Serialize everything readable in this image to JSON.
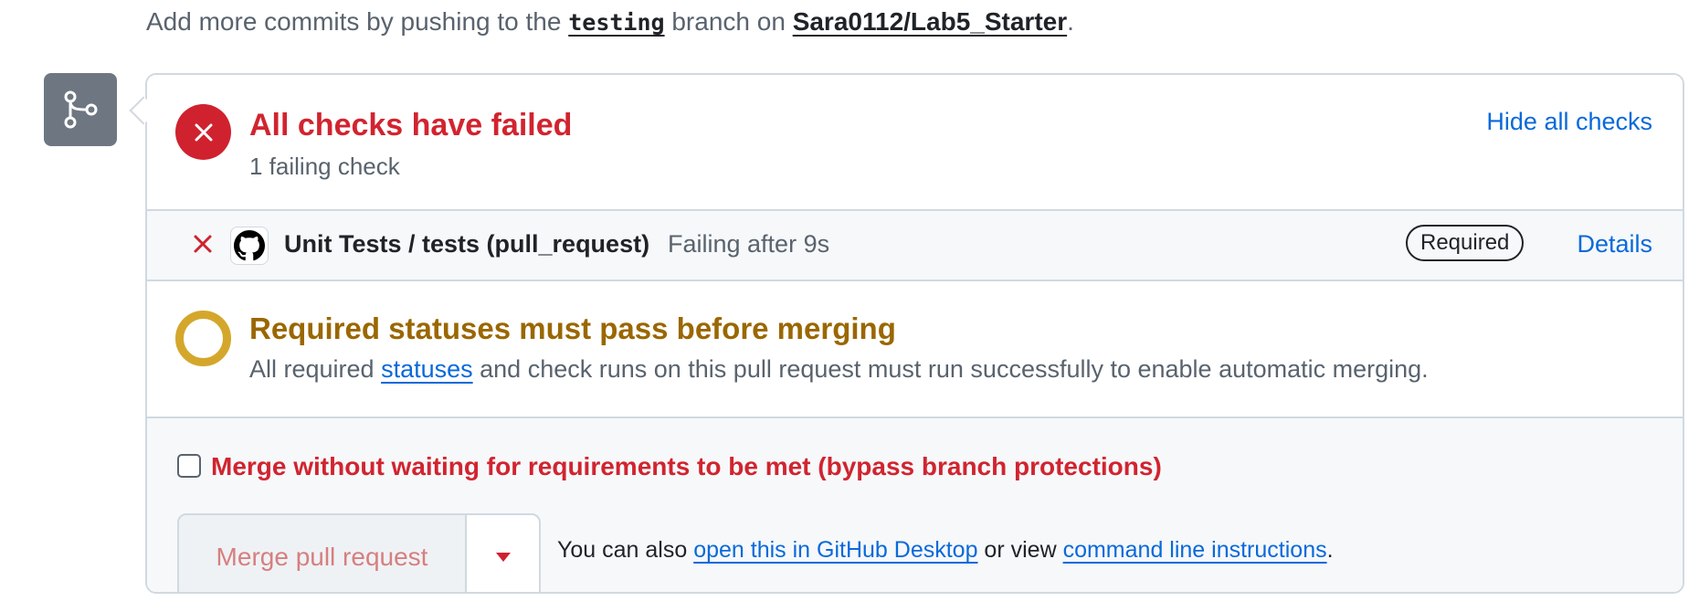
{
  "top_note": {
    "prefix": "Add more commits by pushing to the ",
    "branch": "testing",
    "middle": " branch on ",
    "repo": "Sara0112/Lab5_Starter",
    "suffix": "."
  },
  "checks_summary": {
    "title": "All checks have failed",
    "subtitle": "1 failing check",
    "hide_link": "Hide all checks",
    "status_color": "#cf222e"
  },
  "check_row": {
    "name": "Unit Tests / tests (pull_request)",
    "status": "Failing after 9s",
    "badge": "Required",
    "details_link": "Details",
    "icon": "github-mark-icon"
  },
  "required_statuses": {
    "title": "Required statuses must pass before merging",
    "sub_prefix": "All required ",
    "sub_link": "statuses",
    "sub_suffix": " and check runs on this pull request must run successfully to enable automatic merging.",
    "status_color": "#d4a72c"
  },
  "merge": {
    "bypass_label": "Merge without waiting for requirements to be met (bypass branch protections)",
    "bypass_checked": false,
    "button_label": "Merge pull request",
    "also_prefix": "You can also ",
    "desktop_link": "open this in GitHub Desktop",
    "also_middle": " or view ",
    "cli_link": "command line instructions",
    "also_suffix": "."
  }
}
